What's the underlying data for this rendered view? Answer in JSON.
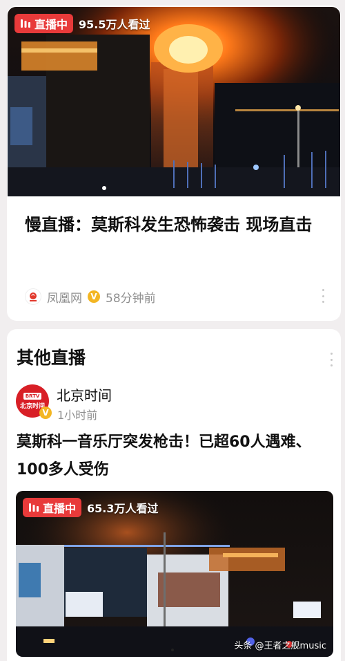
{
  "feed": {
    "featured": {
      "live_label": "直播中",
      "viewers": "95.5万人看过",
      "title": "慢直播：莫斯科发生恐怖袭击 现场直击",
      "source": "凤凰网",
      "source_logo_text": "凤凰卫",
      "time": "58分钟前"
    },
    "other": {
      "section_title": "其他直播",
      "author": {
        "name": "北京时间",
        "avatar_badge": "BRTV",
        "avatar_text": "北京时间",
        "time": "1小时前"
      },
      "title": "莫斯科一音乐厅突发枪击！已超60人遇难、100多人受伤",
      "live_label": "直播中",
      "viewers": "65.3万人看过",
      "watermark": "头条 @王者之舰music"
    }
  },
  "colors": {
    "live_red": "#e83a3a",
    "verified_gold": "#f3b623",
    "brtv_red": "#d81f26",
    "meta_gray": "#8f8f8f"
  },
  "icons": {
    "live": "live-bars-icon",
    "verified": "verified-v-icon",
    "more": "more-vertical-icon"
  }
}
